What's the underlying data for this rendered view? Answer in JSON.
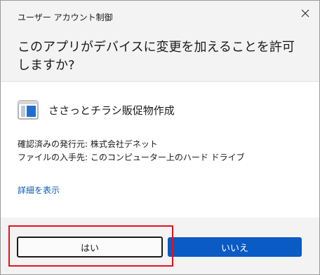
{
  "window": {
    "title": "ユーザー アカウント制御",
    "close_icon": "close-icon"
  },
  "prompt": {
    "question": "このアプリがデバイスに変更を加えることを許可しますか?"
  },
  "app": {
    "icon": "app-window-icon",
    "name": "ささっとチラシ販促物作成"
  },
  "details": {
    "publisher": "確認済みの発行元: 株式会社デネット",
    "origin": "ファイルの入手先: このコンピューター上のハード ドライブ"
  },
  "more_details_label": "詳細を表示",
  "buttons": {
    "yes_label": "はい",
    "no_label": "いいえ"
  },
  "colors": {
    "header_bg": "#f3f3f3",
    "primary_button": "#0a5bc4",
    "link": "#0a5bb6",
    "highlight": "#e8101a"
  }
}
